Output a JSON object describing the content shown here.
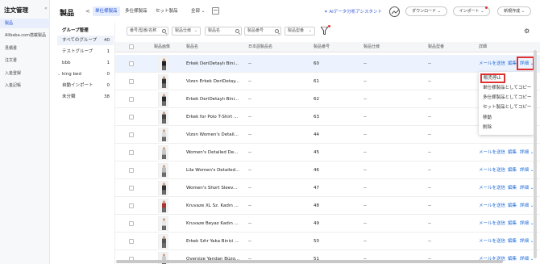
{
  "sidebar": {
    "title": "注文管理",
    "collapse_glyph": "«",
    "items": [
      {
        "label": "製品",
        "active": true
      },
      {
        "label": "Alibaba.com搭載製品",
        "active": false
      },
      {
        "label": "見積書",
        "active": false
      },
      {
        "label": "注文書",
        "active": false
      },
      {
        "label": "入金登録",
        "active": false
      },
      {
        "label": "入金記帳",
        "active": false
      }
    ]
  },
  "header": {
    "title": "製品",
    "back_glyph": "<",
    "tabs": [
      {
        "label": "単仕様製品",
        "active": true
      },
      {
        "label": "多仕様製品",
        "active": false
      },
      {
        "label": "セット製品",
        "active": false
      }
    ],
    "all_dropdown": "全部 ⌄",
    "ai_assistant": "✦ AIデータ分析アシスタント",
    "download": "ダウンロード ⌄",
    "import": "インポート ⌄",
    "new": "新規作成 ⌄"
  },
  "groups": {
    "title": "グループ管理",
    "items": [
      {
        "label": "すべてのグループ",
        "count": "40",
        "active": true,
        "caret": ""
      },
      {
        "label": "テストグループ",
        "count": "1",
        "active": false,
        "caret": ""
      },
      {
        "label": "bbb",
        "count": "1",
        "active": false,
        "caret": ""
      },
      {
        "label": "king bed",
        "count": "0",
        "active": false,
        "caret": "⌄"
      },
      {
        "label": "自動インポート",
        "count": "0",
        "active": false,
        "caret": ""
      },
      {
        "label": "未分類",
        "count": "38",
        "active": false,
        "caret": ""
      }
    ]
  },
  "filters": {
    "product_name_search": "番号/型番/名称",
    "product_spec": "製品仕様",
    "product_name": "製品名",
    "product_number": "製品番号",
    "product_model": "製品型番"
  },
  "table": {
    "headers": {
      "image": "製品画像",
      "name": "製品名",
      "japanese_name": "日本語製品名",
      "number": "製品番号",
      "spec": "製品仕様",
      "model": "製品型番",
      "detail": "詳細"
    },
    "rows": [
      {
        "name": "Erkek DeriDetaylı Bini...",
        "jp": "--",
        "number": "60",
        "spec": "--",
        "model": "--",
        "mail": "メールを送信",
        "edit": "編集",
        "detail": "詳細 ⌄",
        "highlight": true
      },
      {
        "name": "Vizon Erkek DeriDetay...",
        "jp": "--",
        "number": "61",
        "spec": "--",
        "model": "--",
        "mail": "",
        "edit": "",
        "detail": "",
        "highlight": false
      },
      {
        "name": "Erkek DeriDetaylı Bini...",
        "jp": "--",
        "number": "62",
        "spec": "--",
        "model": "--",
        "mail": "",
        "edit": "",
        "detail": "",
        "highlight": false
      },
      {
        "name": "Erkek for Polo T-Shirt ...",
        "jp": "--",
        "number": "63",
        "spec": "--",
        "model": "--",
        "mail": "",
        "edit": "",
        "detail": "",
        "highlight": false
      },
      {
        "name": "Vizon Women's Detail...",
        "jp": "--",
        "number": "44",
        "spec": "--",
        "model": "--",
        "mail": "",
        "edit": "",
        "detail": "",
        "highlight": false
      },
      {
        "name": "Women's Detailed De...",
        "jp": "--",
        "number": "45",
        "spec": "--",
        "model": "--",
        "mail": "メールを送信",
        "edit": "編集",
        "detail": "詳細 ⌄",
        "highlight": false
      },
      {
        "name": "Lila Women's Detailed...",
        "jp": "--",
        "number": "46",
        "spec": "--",
        "model": "--",
        "mail": "メールを送信",
        "edit": "編集",
        "detail": "詳細 ⌄",
        "highlight": false
      },
      {
        "name": "Women's Short Sleev...",
        "jp": "--",
        "number": "47",
        "spec": "--",
        "model": "--",
        "mail": "メールを送信",
        "edit": "編集",
        "detail": "詳細 ⌄",
        "highlight": false
      },
      {
        "name": "Kruvaze XL Sz. Kadın ...",
        "jp": "--",
        "number": "48",
        "spec": "--",
        "model": "--",
        "mail": "メールを送信",
        "edit": "編集",
        "detail": "詳細 ⌄",
        "highlight": false
      },
      {
        "name": "Kruvaze Beyaz Kadın ...",
        "jp": "--",
        "number": "49",
        "spec": "--",
        "model": "--",
        "mail": "メールを送信",
        "edit": "編集",
        "detail": "詳細 ⌄",
        "highlight": false
      },
      {
        "name": "Erkek Sıfır Yaka Binici ...",
        "jp": "--",
        "number": "50",
        "spec": "--",
        "model": "--",
        "mail": "メールを送信",
        "edit": "編集",
        "detail": "詳細 ⌄",
        "highlight": false
      },
      {
        "name": "Oversize Yandan Büzg...",
        "jp": "--",
        "number": "51",
        "spec": "--",
        "model": "--",
        "mail": "メールを送信",
        "edit": "編集",
        "detail": "詳細 ⌄",
        "highlight": false
      }
    ]
  },
  "dropdown_menu": {
    "items": [
      "販売停止",
      "単仕様製品としてコピー",
      "多仕様製品としてコピー",
      "セット製品としてコピー",
      "移動",
      "削除"
    ]
  },
  "colors": {
    "accent": "#1f4fd8",
    "link": "#1f6bd8",
    "highlight_border": "#e03131",
    "selected_row": "#edf3fe"
  }
}
